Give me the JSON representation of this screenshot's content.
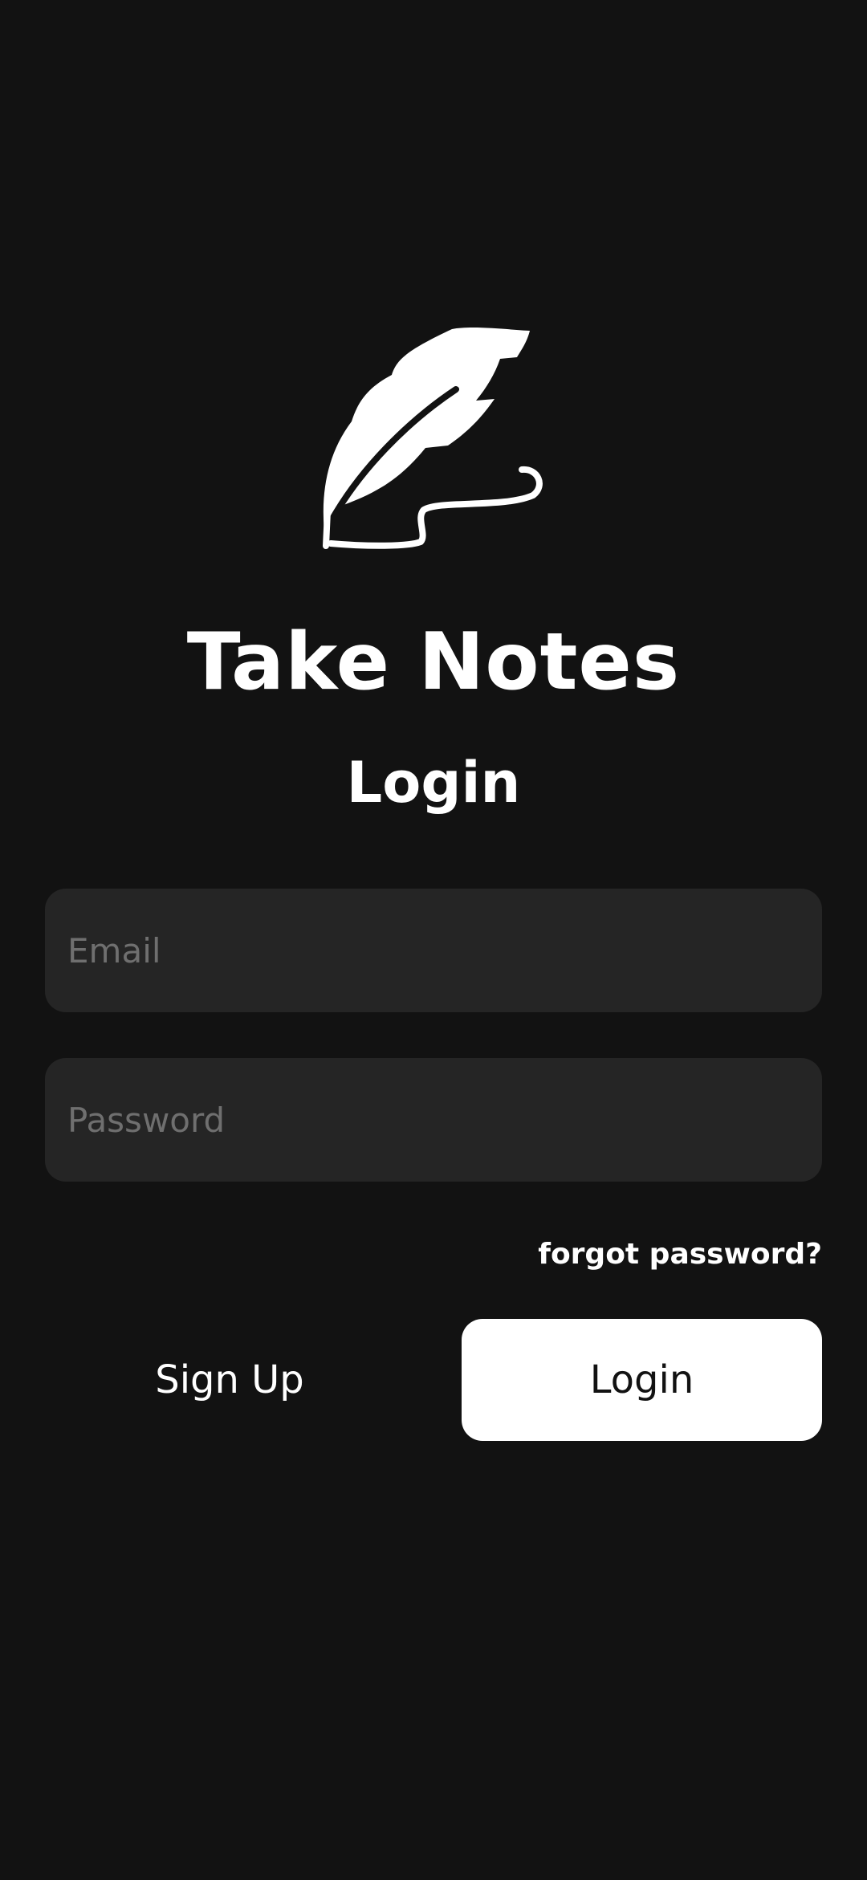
{
  "app": {
    "title": "Take Notes",
    "logo_icon": "feather-quill-icon"
  },
  "login": {
    "heading": "Login",
    "email_placeholder": "Email",
    "email_value": "",
    "password_placeholder": "Password",
    "password_value": "",
    "forgot_password_label": "forgot password?",
    "signup_label": "Sign Up",
    "login_label": "Login"
  },
  "colors": {
    "background": "#121212",
    "input_background": "#252525",
    "placeholder": "#6f6f6f",
    "text": "#ffffff",
    "primary_button": "#ffffff",
    "primary_button_text": "#121212"
  }
}
